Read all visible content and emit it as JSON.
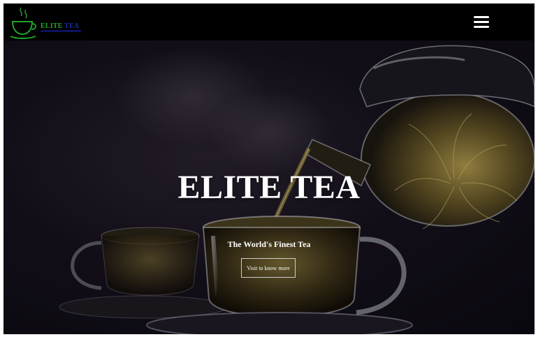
{
  "navbar": {
    "logo_word1": "ELITE",
    "logo_word2": "TEA",
    "menu_icon": "hamburger-menu-icon"
  },
  "hero": {
    "title": "ELITE TEA",
    "subtitle": "The World's Finest Tea",
    "cta_label": "Visit to know more",
    "background_image": "teapot pouring tea into glass cups"
  },
  "colors": {
    "navbar_bg": "#000000",
    "logo_green": "#22a52a",
    "logo_blue": "#1c2f9a",
    "hero_text": "#ffffff"
  }
}
